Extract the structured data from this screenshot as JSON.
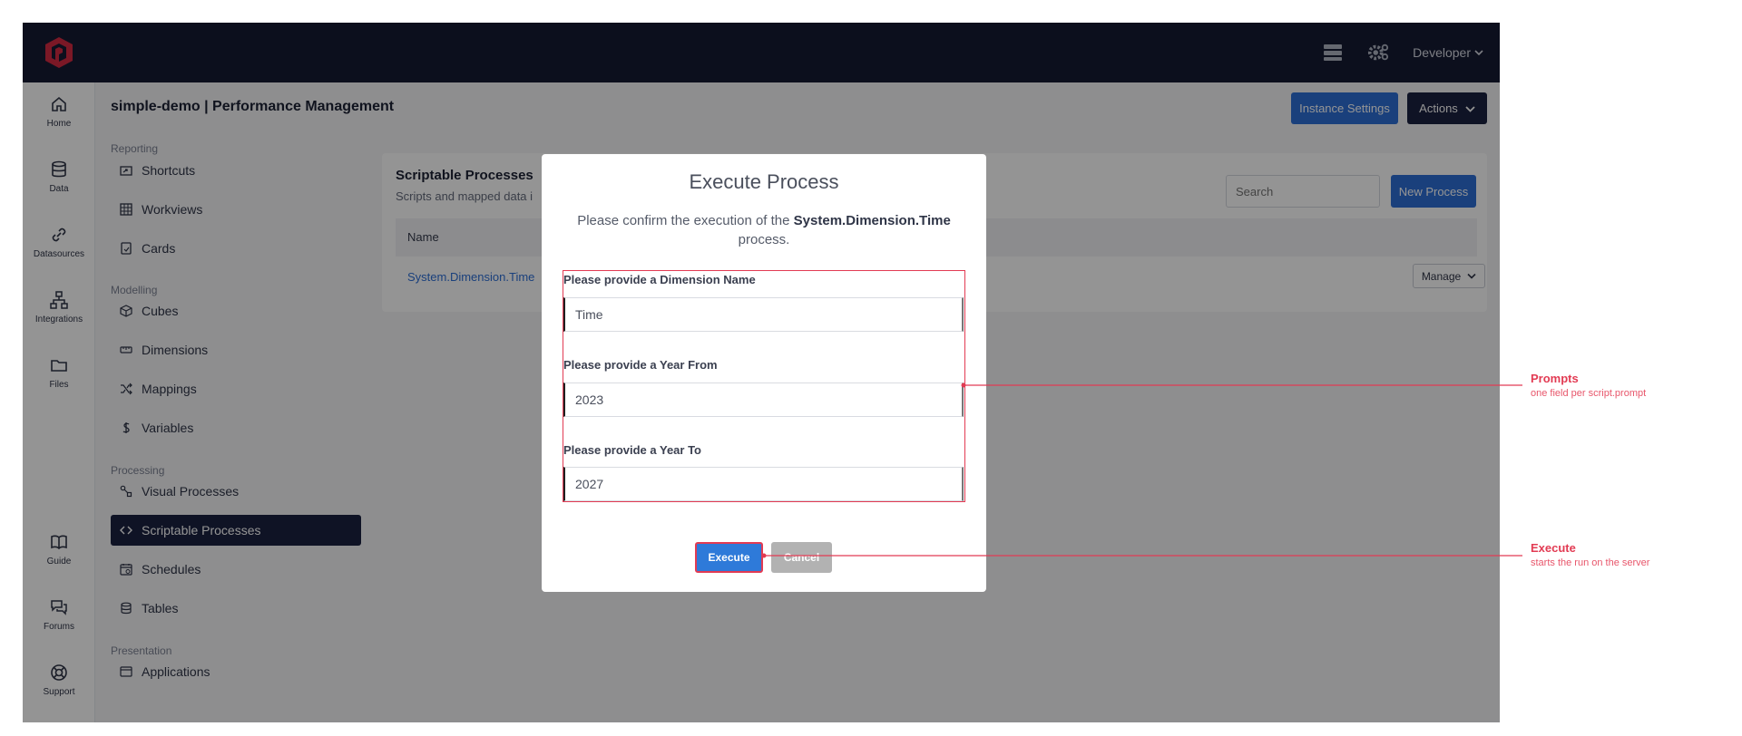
{
  "topbar": {
    "user_menu": "Developer",
    "icons": [
      "server-icon",
      "settings-icon",
      "chevron-down-icon"
    ]
  },
  "iconrail": {
    "items": [
      {
        "label": "Home",
        "icon": "home-icon"
      },
      {
        "label": "Data",
        "icon": "database-icon"
      },
      {
        "label": "Datasources",
        "icon": "link-icon"
      },
      {
        "label": "Integrations",
        "icon": "network-icon"
      },
      {
        "label": "Files",
        "icon": "folder-icon"
      },
      {
        "label": "Guide",
        "icon": "book-icon"
      },
      {
        "label": "Forums",
        "icon": "chat-icon"
      },
      {
        "label": "Support",
        "icon": "lifebuoy-icon"
      }
    ]
  },
  "header": {
    "title": "simple-demo | Performance Management",
    "instance_settings": "Instance Settings",
    "actions": "Actions"
  },
  "sidebar": {
    "sections": [
      "Reporting",
      "Modelling",
      "Processing",
      "Presentation"
    ],
    "items": [
      {
        "label": "Shortcuts",
        "icon": "shortcut-icon"
      },
      {
        "label": "Workviews",
        "icon": "grid-icon"
      },
      {
        "label": "Cards",
        "icon": "card-icon"
      },
      {
        "label": "Cubes",
        "icon": "cube-icon"
      },
      {
        "label": "Dimensions",
        "icon": "ruler-icon"
      },
      {
        "label": "Mappings",
        "icon": "shuffle-icon"
      },
      {
        "label": "Variables",
        "icon": "dollar-icon"
      },
      {
        "label": "Visual Processes",
        "icon": "flow-icon"
      },
      {
        "label": "Scriptable Processes",
        "icon": "code-icon"
      },
      {
        "label": "Schedules",
        "icon": "calendar-icon"
      },
      {
        "label": "Tables",
        "icon": "database-icon"
      },
      {
        "label": "Applications",
        "icon": "window-icon"
      }
    ]
  },
  "main": {
    "card_title": "Scriptable Processes",
    "card_subtitle": "Scripts and mapped data i",
    "search_placeholder": "Search",
    "new_process": "New Process",
    "table_header_name": "Name",
    "row_name": "System.Dimension.Time",
    "manage": "Manage"
  },
  "modal": {
    "title": "Execute Process",
    "text_before": "Please confirm the execution of the ",
    "process_name": "System.Dimension.Time",
    "text_after": "process.",
    "prompts": [
      {
        "label": "Please provide a Dimension Name",
        "value": "Time"
      },
      {
        "label": "Please provide a Year From",
        "value": "2023"
      },
      {
        "label": "Please provide a Year To",
        "value": "2027"
      }
    ],
    "execute": "Execute",
    "cancel": "Cancel"
  },
  "annotations": {
    "prompts_title": "Prompts",
    "prompts_sub": "one field per script.prompt",
    "execute_title": "Execute",
    "execute_sub": "starts the run on the server"
  },
  "colors": {
    "topbar": "#161b33",
    "primary": "#2e6fd6",
    "accent": "#e23b53",
    "active_nav": "#1b2140"
  }
}
